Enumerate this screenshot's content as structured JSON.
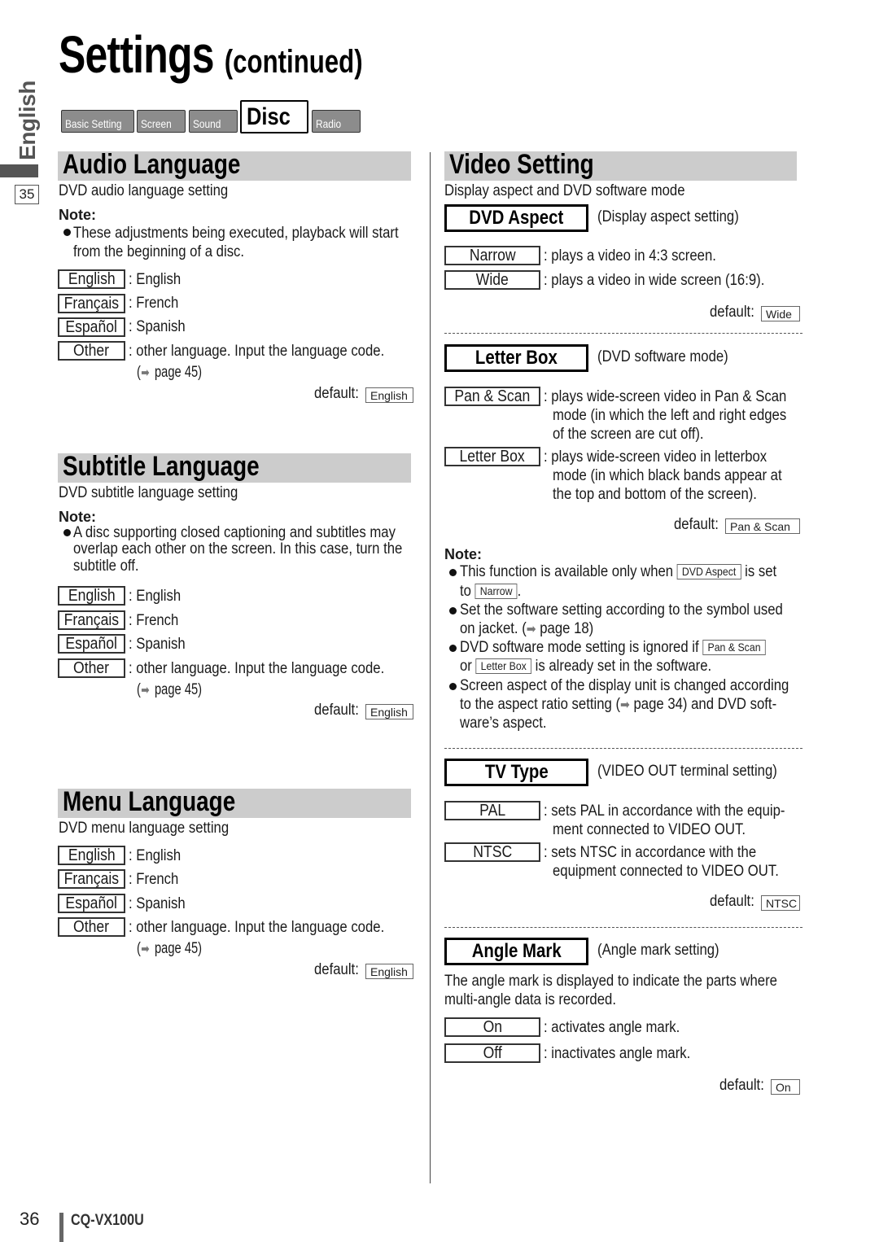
{
  "page": {
    "title": "Settings",
    "title_suffix": "(continued)",
    "side_language": "English",
    "side_page_ref": "35",
    "footer_page": "36",
    "footer_model": "CQ-VX100U"
  },
  "tabs": [
    {
      "label": "Basic Setting",
      "active": false
    },
    {
      "label": "Screen",
      "active": false
    },
    {
      "label": "Sound",
      "active": false
    },
    {
      "label": "Disc",
      "active": true
    },
    {
      "label": "Radio",
      "active": false
    }
  ],
  "common": {
    "note_label": "Note:",
    "default_label": "default:",
    "arrow_icon": "right-arrow",
    "page45": "page 45)",
    "paren_open": "("
  },
  "audio": {
    "heading": "Audio Language",
    "description": "DVD audio language setting",
    "note": [
      "These adjustments being executed, playback will start",
      "from the beginning of a disc."
    ],
    "options": [
      {
        "label": "English",
        "desc": ": English"
      },
      {
        "label": "Français",
        "desc": ": French"
      },
      {
        "label": "Español",
        "desc": ": Spanish"
      },
      {
        "label": "Other",
        "desc": ": other language. Input the language code."
      }
    ],
    "default": "English"
  },
  "subtitle": {
    "heading": "Subtitle Language",
    "description": "DVD subtitle language setting",
    "note": [
      "A disc supporting closed captioning and subtitles may",
      "overlap each other on the screen. In this case, turn the",
      "subtitle off."
    ],
    "options": [
      {
        "label": "English",
        "desc": ": English"
      },
      {
        "label": "Français",
        "desc": ": French"
      },
      {
        "label": "Español",
        "desc": ": Spanish"
      },
      {
        "label": "Other",
        "desc": ": other language. Input the language code."
      }
    ],
    "default": "English"
  },
  "menu": {
    "heading": "Menu Language",
    "description": "DVD menu language setting",
    "options": [
      {
        "label": "English",
        "desc": ": English"
      },
      {
        "label": "Français",
        "desc": ": French"
      },
      {
        "label": "Español",
        "desc": ": Spanish"
      },
      {
        "label": "Other",
        "desc": ": other language. Input the language code."
      }
    ],
    "default": "English"
  },
  "video": {
    "heading": "Video Setting",
    "description": "Display aspect and DVD software mode",
    "dvd_aspect": {
      "title": "DVD Aspect",
      "subtitle": "(Display aspect setting)",
      "options": [
        {
          "label": "Narrow",
          "desc": ": plays a video in 4:3 screen."
        },
        {
          "label": "Wide",
          "desc": ": plays a video in wide screen (16:9)."
        }
      ],
      "default": "Wide"
    },
    "letter_box": {
      "title": "Letter Box",
      "subtitle": "(DVD software mode)",
      "options": [
        {
          "label": "Pan & Scan",
          "desc": [
            ": plays wide-screen video in Pan & Scan",
            "mode (in which the left and right edges",
            "of the screen are cut off)."
          ]
        },
        {
          "label": "Letter Box",
          "desc": [
            ": plays wide-screen video in letterbox",
            "mode (in which black bands appear at",
            "the top and bottom of the screen)."
          ]
        }
      ],
      "default": "Pan & Scan"
    },
    "notes": {
      "n1a": "This function is available only when",
      "n1box": "DVD Aspect",
      "n1b": "is set",
      "n1c": "to",
      "n1box2": "Narrow",
      "n1d": ".",
      "n2a": "Set the software setting according to the symbol used",
      "n2b": "on jacket. (",
      "n2c": "page 18)",
      "n3a": "DVD software mode setting is ignored if",
      "n3box": "Pan & Scan",
      "n3b": "or",
      "n3box2": "Letter Box",
      "n3c": "is already set in the software.",
      "n4a": "Screen aspect of the display unit is changed according",
      "n4b": "to the aspect ratio setting (",
      "n4c": "page 34) and DVD soft-",
      "n4d": "ware’s aspect."
    },
    "tv_type": {
      "title": "TV Type",
      "subtitle": "(VIDEO OUT terminal setting)",
      "options": [
        {
          "label": "PAL",
          "desc": [
            ": sets PAL in accordance with the equip-",
            "ment connected to VIDEO OUT."
          ]
        },
        {
          "label": "NTSC",
          "desc": [
            ": sets NTSC in accordance with the",
            "equipment connected to VIDEO OUT."
          ]
        }
      ],
      "default": "NTSC"
    },
    "angle_mark": {
      "title": "Angle Mark",
      "subtitle": "(Angle mark setting)",
      "description": [
        "The angle mark is displayed to indicate the parts where",
        "multi-angle data is recorded."
      ],
      "options": [
        {
          "label": "On",
          "desc": ": activates angle mark."
        },
        {
          "label": "Off",
          "desc": ": inactivates angle mark."
        }
      ],
      "default": "On"
    }
  }
}
